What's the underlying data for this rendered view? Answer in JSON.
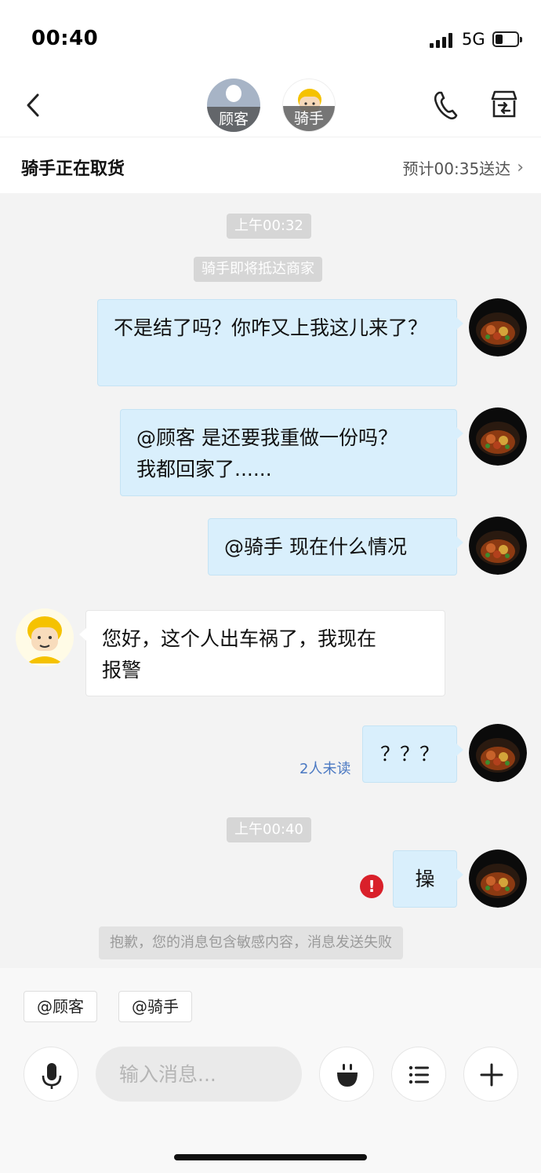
{
  "status_bar": {
    "time": "00:40",
    "network": "5G",
    "battery_fraction": 0.35
  },
  "header": {
    "participants": [
      {
        "label": "顾客",
        "icon": "customer-avatar"
      },
      {
        "label": "骑手",
        "icon": "rider-avatar"
      }
    ],
    "icons": [
      "back-icon",
      "phone-icon",
      "shop-icon"
    ]
  },
  "order": {
    "status": "骑手正在取货",
    "eta": "预计00:35送达"
  },
  "chat": {
    "time_1": "上午00:32",
    "notice_1": "骑手即将抵达商家",
    "messages": [
      {
        "from": "merchant",
        "text": "不是结了吗？你咋又上我这儿来了？"
      },
      {
        "from": "merchant",
        "text_line1": "@顾客 是还要我重做一份吗？",
        "text_line2": "我都回家了......"
      },
      {
        "from": "merchant",
        "text": "@骑手 现在什么情况"
      },
      {
        "from": "rider",
        "text_line1": "您好，这个人出车祸了，我现在",
        "text_line2": "报警"
      },
      {
        "from": "merchant",
        "text": "？？？",
        "unread": "2人未读"
      },
      {
        "from": "merchant",
        "text": "操",
        "failed": true,
        "error_icon": "!"
      }
    ],
    "time_2": "上午00:40",
    "failure_notice": "抱歉，您的消息包含敏感内容，消息发送失败"
  },
  "mentions": [
    "@顾客",
    "@骑手"
  ],
  "input": {
    "placeholder": "输入消息...",
    "icons": [
      "mic-icon",
      "emoji-icon",
      "list-icon",
      "plus-icon"
    ]
  }
}
